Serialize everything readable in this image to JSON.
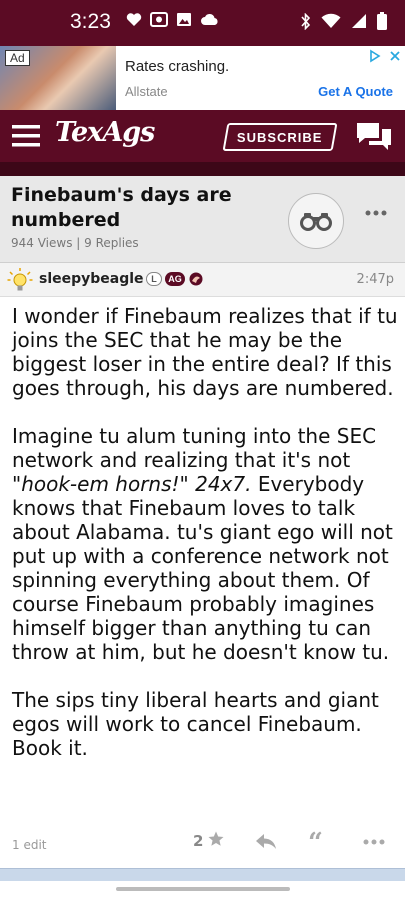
{
  "status_bar": {
    "time": "3:23"
  },
  "ad": {
    "badge": "Ad",
    "headline": "Rates crashing.",
    "advertiser": "Allstate",
    "cta": "Get A Quote"
  },
  "appbar": {
    "logo": "TexAgs",
    "subscribe": "SUBSCRIBE"
  },
  "thread": {
    "title": "Finebaum's days are numbered",
    "meta": "944 Views | 9 Replies"
  },
  "post": {
    "author": "sleepybeagle",
    "badge_l": "L",
    "badge_ag": "AG",
    "time": "2:47p",
    "p1": "I wonder if Finebaum realizes that if tu joins the SEC that he may be the biggest loser in the entire deal? If this goes through, his days are numbered.",
    "p2_a": "Imagine tu alum tuning into the SEC network and realizing that it's not ",
    "p2_em": "\"hook-em horns!\" 24x7.",
    "p2_b": " Everybody knows that Finebaum loves to talk about Alabama. tu's giant ego will not put up with a conference network not spinning everything about them. Of course Finebaum probably imagines himself bigger than anything tu can throw at him, but he doesn't know tu.",
    "p3": "The sips tiny liberal hearts and giant egos will work to cancel Finebaum. Book it.",
    "edits": "1 edit",
    "star_count": "2"
  },
  "colors": {
    "brand_maroon": "#5b0b24",
    "link_blue": "#1a73e8"
  }
}
